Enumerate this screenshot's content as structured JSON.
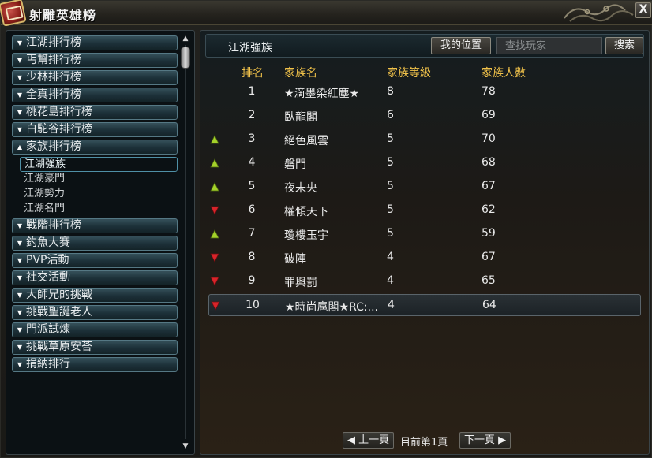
{
  "window": {
    "title": "射雕英雄榜",
    "close_label": "X"
  },
  "sidebar": {
    "items": [
      {
        "label": "江湖排行榜",
        "expanded": false
      },
      {
        "label": "丐幫排行榜",
        "expanded": false
      },
      {
        "label": "少林排行榜",
        "expanded": false
      },
      {
        "label": "全真排行榜",
        "expanded": false
      },
      {
        "label": "桃花島排行榜",
        "expanded": false
      },
      {
        "label": "白駝谷排行榜",
        "expanded": false
      },
      {
        "label": "家族排行榜",
        "expanded": true,
        "children": [
          "江湖強族",
          "江湖豪門",
          "江湖勢力",
          "江湖名門"
        ]
      },
      {
        "label": "戰階排行榜",
        "expanded": false
      },
      {
        "label": "釣魚大賽",
        "expanded": false
      },
      {
        "label": "PVP活動",
        "expanded": false
      },
      {
        "label": "社交活動",
        "expanded": false
      },
      {
        "label": "大師兄的挑戰",
        "expanded": false
      },
      {
        "label": "挑戰聖誕老人",
        "expanded": false
      },
      {
        "label": "門派試煉",
        "expanded": false
      },
      {
        "label": "挑戰草原安荅",
        "expanded": false
      },
      {
        "label": "捐納排行",
        "expanded": false
      }
    ],
    "selected_child": "江湖強族"
  },
  "header": {
    "title": "江湖強族",
    "my_position_label": "我的位置",
    "search_placeholder": "查找玩家",
    "search_label": "搜索"
  },
  "table": {
    "columns": {
      "rank": "排名",
      "name": "家族名",
      "level": "家族等級",
      "members": "家族人數"
    },
    "rows": [
      {
        "rank": "1",
        "name": "★滴墨染紅塵★",
        "level": "8",
        "members": "78",
        "trend": "none"
      },
      {
        "rank": "2",
        "name": "臥龍閣",
        "level": "6",
        "members": "69",
        "trend": "none"
      },
      {
        "rank": "3",
        "name": "絕色風雲",
        "level": "5",
        "members": "70",
        "trend": "up"
      },
      {
        "rank": "4",
        "name": "磐門",
        "level": "5",
        "members": "68",
        "trend": "up"
      },
      {
        "rank": "5",
        "name": "夜未央",
        "level": "5",
        "members": "67",
        "trend": "up"
      },
      {
        "rank": "6",
        "name": "權傾天下",
        "level": "5",
        "members": "62",
        "trend": "down"
      },
      {
        "rank": "7",
        "name": "瓊樓玉宇",
        "level": "5",
        "members": "59",
        "trend": "up"
      },
      {
        "rank": "8",
        "name": "破陣",
        "level": "4",
        "members": "67",
        "trend": "down"
      },
      {
        "rank": "9",
        "name": "罪與罰",
        "level": "4",
        "members": "65",
        "trend": "down"
      },
      {
        "rank": "10",
        "name": "★時尚扈閣★RC:...",
        "level": "4",
        "members": "64",
        "trend": "down"
      }
    ]
  },
  "pager": {
    "prev_label": "上一頁",
    "current_text": "目前第1頁",
    "next_label": "下一頁"
  },
  "colors": {
    "header_gold": "#f1c24a",
    "up_arrow": "#a4d12a",
    "down_arrow": "#d8242a"
  }
}
